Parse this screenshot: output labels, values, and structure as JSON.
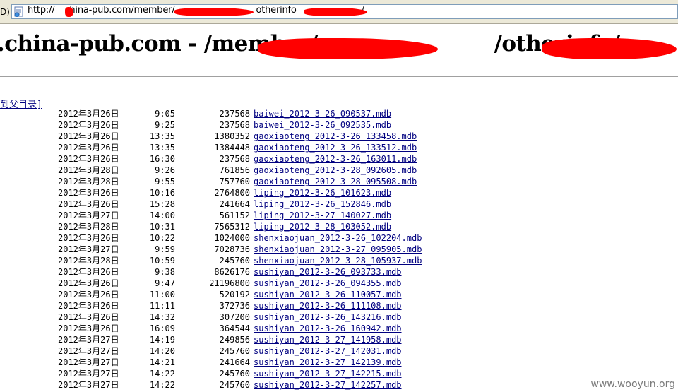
{
  "address_bar": {
    "left_label": "D)",
    "url_prefix": "http://",
    "url_host": "china-pub.com/member/",
    "url_mid": "otherinfo",
    "url_end": "/"
  },
  "heading": {
    "host": ".china-pub.com - /member/",
    "mid": "/otherinfo/"
  },
  "parent_link": "到父目录]",
  "files": [
    {
      "date": "2012年3月26日",
      "time": "9:05",
      "size": "237568",
      "name": "baiwei_2012-3-26_090537.mdb"
    },
    {
      "date": "2012年3月26日",
      "time": "9:25",
      "size": "237568",
      "name": "baiwei_2012-3-26_092535.mdb"
    },
    {
      "date": "2012年3月26日",
      "time": "13:35",
      "size": "1380352",
      "name": "gaoxiaoteng_2012-3-26_133458.mdb"
    },
    {
      "date": "2012年3月26日",
      "time": "13:35",
      "size": "1384448",
      "name": "gaoxiaoteng_2012-3-26_133512.mdb"
    },
    {
      "date": "2012年3月26日",
      "time": "16:30",
      "size": "237568",
      "name": "gaoxiaoteng_2012-3-26_163011.mdb"
    },
    {
      "date": "2012年3月28日",
      "time": "9:26",
      "size": "761856",
      "name": "gaoxiaoteng_2012-3-28_092605.mdb"
    },
    {
      "date": "2012年3月28日",
      "time": "9:55",
      "size": "757760",
      "name": "gaoxiaoteng_2012-3-28_095508.mdb"
    },
    {
      "date": "2012年3月26日",
      "time": "10:16",
      "size": "2764800",
      "name": "liping_2012-3-26_101623.mdb"
    },
    {
      "date": "2012年3月26日",
      "time": "15:28",
      "size": "241664",
      "name": "liping_2012-3-26_152846.mdb"
    },
    {
      "date": "2012年3月27日",
      "time": "14:00",
      "size": "561152",
      "name": "liping_2012-3-27_140027.mdb"
    },
    {
      "date": "2012年3月28日",
      "time": "10:31",
      "size": "7565312",
      "name": "liping_2012-3-28_103052.mdb"
    },
    {
      "date": "2012年3月26日",
      "time": "10:22",
      "size": "1024000",
      "name": "shenxiaojuan_2012-3-26_102204.mdb"
    },
    {
      "date": "2012年3月27日",
      "time": "9:59",
      "size": "7028736",
      "name": "shenxiaojuan_2012-3-27_095905.mdb"
    },
    {
      "date": "2012年3月28日",
      "time": "10:59",
      "size": "245760",
      "name": "shenxiaojuan_2012-3-28_105937.mdb"
    },
    {
      "date": "2012年3月26日",
      "time": "9:38",
      "size": "8626176",
      "name": "sushiyan_2012-3-26_093733.mdb"
    },
    {
      "date": "2012年3月26日",
      "time": "9:47",
      "size": "21196800",
      "name": "sushiyan_2012-3-26_094355.mdb"
    },
    {
      "date": "2012年3月26日",
      "time": "11:00",
      "size": "520192",
      "name": "sushiyan_2012-3-26_110057.mdb"
    },
    {
      "date": "2012年3月26日",
      "time": "11:11",
      "size": "372736",
      "name": "sushiyan_2012-3-26_111108.mdb"
    },
    {
      "date": "2012年3月26日",
      "time": "14:32",
      "size": "307200",
      "name": "sushiyan_2012-3-26_143216.mdb"
    },
    {
      "date": "2012年3月26日",
      "time": "16:09",
      "size": "364544",
      "name": "sushiyan_2012-3-26_160942.mdb"
    },
    {
      "date": "2012年3月27日",
      "time": "14:19",
      "size": "249856",
      "name": "sushiyan_2012-3-27_141958.mdb"
    },
    {
      "date": "2012年3月27日",
      "time": "14:20",
      "size": "245760",
      "name": "sushiyan_2012-3-27_142031.mdb"
    },
    {
      "date": "2012年3月27日",
      "time": "14:21",
      "size": "241664",
      "name": "sushiyan_2012-3-27_142139.mdb"
    },
    {
      "date": "2012年3月27日",
      "time": "14:22",
      "size": "245760",
      "name": "sushiyan_2012-3-27_142215.mdb"
    },
    {
      "date": "2012年3月27日",
      "time": "14:22",
      "size": "245760",
      "name": "sushiyan_2012-3-27_142257.mdb"
    }
  ],
  "watermark": "www.wooyun.org",
  "colors": {
    "link": "#000080",
    "redaction": "#ff0000",
    "chrome": "#ece9d8"
  }
}
